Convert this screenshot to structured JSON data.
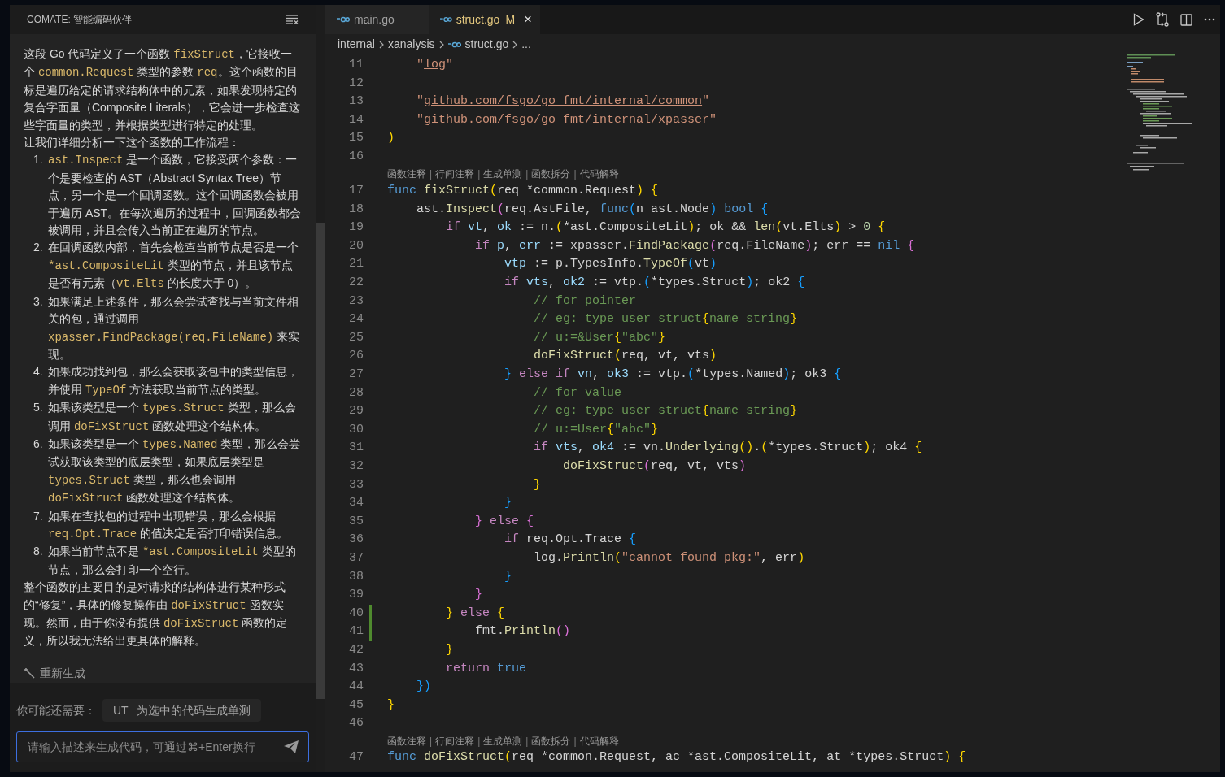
{
  "chat": {
    "title": "COMATE: 智能编码伙伴",
    "blocks": [
      {
        "kind": "para",
        "segments": [
          {
            "text": "这段 Go 代码定义了一个函数 ",
            "code": false
          },
          {
            "text": "fixStruct",
            "code": true
          },
          {
            "text": "，它接收一个 ",
            "code": false
          },
          {
            "text": "common.Request",
            "code": true
          },
          {
            "text": " 类型的参数 ",
            "code": false
          },
          {
            "text": "req",
            "code": true
          },
          {
            "text": "。这个函数的目标是遍历给定的请求结构体中的元素，如果发现特定的复合字面量（Composite Literals），它会进一步检查这些字面量的类型，并根据类型进行特定的处理。",
            "code": false
          }
        ]
      },
      {
        "kind": "para",
        "segments": [
          {
            "text": "让我们详细分析一下这个函数的工作流程：",
            "code": false
          }
        ]
      },
      {
        "kind": "item",
        "number": "1.",
        "segments": [
          {
            "text": "ast.Inspect",
            "code": true
          },
          {
            "text": " 是一个函数，它接受两个参数：一个是要检查的 AST（Abstract Syntax Tree）节点，另一个是一个回调函数。这个回调函数会被用于遍历 AST。在每次遍历的过程中，回调函数都会被调用，并且会传入当前正在遍历的节点。",
            "code": false
          }
        ]
      },
      {
        "kind": "item",
        "number": "2.",
        "segments": [
          {
            "text": "在回调函数内部，首先会检查当前节点是否是一个 ",
            "code": false
          },
          {
            "text": "*ast.CompositeLit",
            "code": true
          },
          {
            "text": " 类型的节点，并且该节点是否有元素（",
            "code": false
          },
          {
            "text": "vt.Elts",
            "code": true
          },
          {
            "text": " 的长度大于 0）。",
            "code": false
          }
        ]
      },
      {
        "kind": "item",
        "number": "3.",
        "segments": [
          {
            "text": "如果满足上述条件，那么会尝试查找与当前文件相关的包，通过调用 ",
            "code": false
          },
          {
            "text": "xpasser.FindPackage(req.FileName)",
            "code": true
          },
          {
            "text": " 来实现。",
            "code": false
          }
        ]
      },
      {
        "kind": "item",
        "number": "4.",
        "segments": [
          {
            "text": "如果成功找到包，那么会获取该包中的类型信息，并使用 ",
            "code": false
          },
          {
            "text": "TypeOf",
            "code": true
          },
          {
            "text": " 方法获取当前节点的类型。",
            "code": false
          }
        ]
      },
      {
        "kind": "item",
        "number": "5.",
        "segments": [
          {
            "text": "如果该类型是一个 ",
            "code": false
          },
          {
            "text": "types.Struct",
            "code": true
          },
          {
            "text": " 类型，那么会调用 ",
            "code": false
          },
          {
            "text": "doFixStruct",
            "code": true
          },
          {
            "text": " 函数处理这个结构体。",
            "code": false
          }
        ]
      },
      {
        "kind": "item",
        "number": "6.",
        "segments": [
          {
            "text": "如果该类型是一个 ",
            "code": false
          },
          {
            "text": "types.Named",
            "code": true
          },
          {
            "text": " 类型，那么会尝试获取该类型的底层类型，如果底层类型是 ",
            "code": false
          },
          {
            "text": "types.Struct",
            "code": true
          },
          {
            "text": " 类型，那么也会调用 ",
            "code": false
          },
          {
            "text": "doFixStruct",
            "code": true
          },
          {
            "text": " 函数处理这个结构体。",
            "code": false
          }
        ]
      },
      {
        "kind": "item",
        "number": "7.",
        "segments": [
          {
            "text": "如果在查找包的过程中出现错误，那么会根据 ",
            "code": false
          },
          {
            "text": "req.Opt.Trace",
            "code": true
          },
          {
            "text": " 的值决定是否打印错误信息。",
            "code": false
          }
        ]
      },
      {
        "kind": "item",
        "number": "8.",
        "segments": [
          {
            "text": "如果当前节点不是 ",
            "code": false
          },
          {
            "text": "*ast.CompositeLit",
            "code": true
          },
          {
            "text": " 类型的节点，那么会打印一个空行。",
            "code": false
          }
        ]
      },
      {
        "kind": "para",
        "segments": [
          {
            "text": "整个函数的主要目的是对请求的结构体进行某种形式的“修复”，具体的修复操作由 ",
            "code": false
          },
          {
            "text": "doFixStruct",
            "code": true
          },
          {
            "text": " 函数实现。然而，由于你没有提供 ",
            "code": false
          },
          {
            "text": "doFixStruct",
            "code": true
          },
          {
            "text": " 函数的定义，所以我无法给出更具体的解释。",
            "code": false
          }
        ]
      }
    ],
    "regenerate": "重新生成",
    "suggestion": {
      "label": "你可能还需要：",
      "prefix": "UT",
      "text": "为选中的代码生成单测"
    },
    "input": {
      "placeholder": "请输入描述来生成代码，可通过⌘+Enter换行"
    }
  },
  "tabs": [
    {
      "label": "main.go",
      "selected": false
    },
    {
      "label": "struct.go",
      "badge": "M",
      "close": "×",
      "selected": true
    }
  ],
  "breadcrumbs": [
    "internal",
    "xanalysis",
    "struct.go",
    "..."
  ],
  "lines": [
    {
      "kind": "code",
      "number": "11",
      "changed": false,
      "tokens": [
        {
          "text": "    \"",
          "kind": "s"
        },
        {
          "text": "log",
          "kind": "u"
        },
        {
          "text": "\"",
          "kind": "s"
        }
      ]
    },
    {
      "kind": "code",
      "number": "12",
      "changed": false
    },
    {
      "kind": "code",
      "number": "13",
      "changed": false,
      "tokens": [
        {
          "text": "    \"",
          "kind": "s"
        },
        {
          "text": "github.com/fsgo/go_fmt/internal/common",
          "kind": "u"
        },
        {
          "text": "\"",
          "kind": "s"
        }
      ]
    },
    {
      "kind": "code",
      "number": "14",
      "changed": false,
      "tokens": [
        {
          "text": "    \"",
          "kind": "s"
        },
        {
          "text": "github.com/fsgo/go_fmt/internal/xpasser",
          "kind": "u"
        },
        {
          "text": "\"",
          "kind": "s"
        }
      ]
    },
    {
      "kind": "code",
      "number": "15",
      "changed": false,
      "tokens": [
        {
          "text": ")",
          "kind": "b1"
        }
      ]
    },
    {
      "kind": "code",
      "number": "16",
      "changed": false
    },
    {
      "kind": "lens",
      "actions": [
        {
          "label": "函数注释",
          "kind": "link"
        },
        {
          "label": "|",
          "kind": "separator"
        },
        {
          "label": "行间注释",
          "kind": "link"
        },
        {
          "label": "|",
          "kind": "separator"
        },
        {
          "label": "生成单测",
          "kind": "link"
        },
        {
          "label": "|",
          "kind": "separator"
        },
        {
          "label": "函数拆分",
          "kind": "link"
        },
        {
          "label": "|",
          "kind": "separator"
        },
        {
          "label": "代码解释",
          "kind": "link"
        }
      ]
    },
    {
      "kind": "code",
      "number": "17",
      "changed": false,
      "tokens": [
        {
          "text": "func ",
          "kind": "bl"
        },
        {
          "text": "fixStruct",
          "kind": "f"
        },
        {
          "text": "(",
          "kind": "b1"
        },
        {
          "text": "req *common.Request",
          "kind": "p"
        },
        {
          "text": ") {",
          "kind": "b1"
        }
      ]
    },
    {
      "kind": "code",
      "number": "18",
      "changed": false,
      "tokens": [
        {
          "text": "    ast.",
          "kind": "p"
        },
        {
          "text": "Inspect",
          "kind": "f"
        },
        {
          "text": "(",
          "kind": "b2"
        },
        {
          "text": "req.AstFile, ",
          "kind": "p"
        },
        {
          "text": "func",
          "kind": "bl"
        },
        {
          "text": "(",
          "kind": "b3"
        },
        {
          "text": "n ast.Node",
          "kind": "p"
        },
        {
          "text": ") ",
          "kind": "b3"
        },
        {
          "text": "bool",
          "kind": "bl"
        },
        {
          "text": " {",
          "kind": "b3"
        }
      ]
    },
    {
      "kind": "code",
      "number": "19",
      "changed": false,
      "tokens": [
        {
          "text": "        if ",
          "kind": "kw"
        },
        {
          "text": "vt",
          "kind": "v"
        },
        {
          "text": ", ",
          "kind": "p"
        },
        {
          "text": "ok",
          "kind": "v"
        },
        {
          "text": " := n.",
          "kind": "p"
        },
        {
          "text": "(",
          "kind": "b1"
        },
        {
          "text": "*ast.CompositeLit",
          "kind": "p"
        },
        {
          "text": ")",
          "kind": "b1"
        },
        {
          "text": "; ok && ",
          "kind": "p"
        },
        {
          "text": "len",
          "kind": "f"
        },
        {
          "text": "(",
          "kind": "b1"
        },
        {
          "text": "vt.Elts",
          "kind": "p"
        },
        {
          "text": ")",
          "kind": "b1"
        },
        {
          "text": " > ",
          "kind": "p"
        },
        {
          "text": "0",
          "kind": "n"
        },
        {
          "text": " {",
          "kind": "b1"
        }
      ]
    },
    {
      "kind": "code",
      "number": "20",
      "changed": false,
      "tokens": [
        {
          "text": "            if ",
          "kind": "kw"
        },
        {
          "text": "p",
          "kind": "v"
        },
        {
          "text": ", ",
          "kind": "p"
        },
        {
          "text": "err",
          "kind": "v"
        },
        {
          "text": " := xpasser.",
          "kind": "p"
        },
        {
          "text": "FindPackage",
          "kind": "f"
        },
        {
          "text": "(",
          "kind": "b2"
        },
        {
          "text": "req.FileName",
          "kind": "p"
        },
        {
          "text": ")",
          "kind": "b2"
        },
        {
          "text": "; err == ",
          "kind": "p"
        },
        {
          "text": "nil",
          "kind": "bl"
        },
        {
          "text": " {",
          "kind": "b2"
        }
      ]
    },
    {
      "kind": "code",
      "number": "21",
      "changed": false,
      "tokens": [
        {
          "text": "                vtp",
          "kind": "v"
        },
        {
          "text": " := p.TypesInfo.",
          "kind": "p"
        },
        {
          "text": "TypeOf",
          "kind": "f"
        },
        {
          "text": "(",
          "kind": "b3"
        },
        {
          "text": "vt",
          "kind": "p"
        },
        {
          "text": ")",
          "kind": "b3"
        }
      ]
    },
    {
      "kind": "code",
      "number": "22",
      "changed": false,
      "tokens": [
        {
          "text": "                if ",
          "kind": "kw"
        },
        {
          "text": "vts",
          "kind": "v"
        },
        {
          "text": ", ",
          "kind": "p"
        },
        {
          "text": "ok2",
          "kind": "v"
        },
        {
          "text": " := vtp.",
          "kind": "p"
        },
        {
          "text": "(",
          "kind": "b3"
        },
        {
          "text": "*types.Struct",
          "kind": "p"
        },
        {
          "text": ")",
          "kind": "b3"
        },
        {
          "text": "; ok2 ",
          "kind": "p"
        },
        {
          "text": "{",
          "kind": "b3"
        }
      ]
    },
    {
      "kind": "code",
      "number": "23",
      "changed": false,
      "tokens": [
        {
          "text": "                    // for pointer",
          "kind": "c"
        }
      ]
    },
    {
      "kind": "code",
      "number": "24",
      "changed": false,
      "tokens": [
        {
          "text": "                    // eg: type user struct",
          "kind": "c"
        },
        {
          "text": "{",
          "kind": "b1"
        },
        {
          "text": "name string",
          "kind": "c"
        },
        {
          "text": "}",
          "kind": "b1"
        }
      ]
    },
    {
      "kind": "code",
      "number": "25",
      "changed": false,
      "tokens": [
        {
          "text": "                    // u:=&User",
          "kind": "c"
        },
        {
          "text": "{",
          "kind": "b1"
        },
        {
          "text": "\"abc\"",
          "kind": "c"
        },
        {
          "text": "}",
          "kind": "b1"
        }
      ]
    },
    {
      "kind": "code",
      "number": "26",
      "changed": false,
      "tokens": [
        {
          "text": "                    doFixStruct",
          "kind": "f"
        },
        {
          "text": "(",
          "kind": "b1"
        },
        {
          "text": "req, vt, vts",
          "kind": "p"
        },
        {
          "text": ")",
          "kind": "b1"
        }
      ]
    },
    {
      "kind": "code",
      "number": "27",
      "changed": false,
      "tokens": [
        {
          "text": "                } ",
          "kind": "b3"
        },
        {
          "text": "else if ",
          "kind": "kw"
        },
        {
          "text": "vn",
          "kind": "v"
        },
        {
          "text": ", ",
          "kind": "p"
        },
        {
          "text": "ok3",
          "kind": "v"
        },
        {
          "text": " := vtp.",
          "kind": "p"
        },
        {
          "text": "(",
          "kind": "b3"
        },
        {
          "text": "*types.Named",
          "kind": "p"
        },
        {
          "text": ")",
          "kind": "b3"
        },
        {
          "text": "; ok3 ",
          "kind": "p"
        },
        {
          "text": "{",
          "kind": "b3"
        }
      ]
    },
    {
      "kind": "code",
      "number": "28",
      "changed": false,
      "tokens": [
        {
          "text": "                    // for value",
          "kind": "c"
        }
      ]
    },
    {
      "kind": "code",
      "number": "29",
      "changed": false,
      "tokens": [
        {
          "text": "                    // eg: type user struct",
          "kind": "c"
        },
        {
          "text": "{",
          "kind": "b1"
        },
        {
          "text": "name string",
          "kind": "c"
        },
        {
          "text": "}",
          "kind": "b1"
        }
      ]
    },
    {
      "kind": "code",
      "number": "30",
      "changed": false,
      "tokens": [
        {
          "text": "                    // u:=User",
          "kind": "c"
        },
        {
          "text": "{",
          "kind": "b1"
        },
        {
          "text": "\"abc\"",
          "kind": "c"
        },
        {
          "text": "}",
          "kind": "b1"
        }
      ]
    },
    {
      "kind": "code",
      "number": "31",
      "changed": false,
      "tokens": [
        {
          "text": "                    if ",
          "kind": "kw"
        },
        {
          "text": "vts",
          "kind": "v"
        },
        {
          "text": ", ",
          "kind": "p"
        },
        {
          "text": "ok4",
          "kind": "v"
        },
        {
          "text": " := vn.",
          "kind": "p"
        },
        {
          "text": "Underlying",
          "kind": "f"
        },
        {
          "text": "()",
          "kind": "b1"
        },
        {
          "text": ".",
          "kind": "p"
        },
        {
          "text": "(",
          "kind": "b1"
        },
        {
          "text": "*types.Struct",
          "kind": "p"
        },
        {
          "text": ")",
          "kind": "b1"
        },
        {
          "text": "; ok4 ",
          "kind": "p"
        },
        {
          "text": "{",
          "kind": "b1"
        }
      ]
    },
    {
      "kind": "code",
      "number": "32",
      "changed": false,
      "tokens": [
        {
          "text": "                        doFixStruct",
          "kind": "f"
        },
        {
          "text": "(",
          "kind": "b2"
        },
        {
          "text": "req, vt, vts",
          "kind": "p"
        },
        {
          "text": ")",
          "kind": "b2"
        }
      ]
    },
    {
      "kind": "code",
      "number": "33",
      "changed": false,
      "tokens": [
        {
          "text": "                    }",
          "kind": "b1"
        }
      ]
    },
    {
      "kind": "code",
      "number": "34",
      "changed": false,
      "tokens": [
        {
          "text": "                }",
          "kind": "b3"
        }
      ]
    },
    {
      "kind": "code",
      "number": "35",
      "changed": false,
      "tokens": [
        {
          "text": "            } ",
          "kind": "b2"
        },
        {
          "text": "else ",
          "kind": "kw"
        },
        {
          "text": "{",
          "kind": "b2"
        }
      ]
    },
    {
      "kind": "code",
      "number": "36",
      "changed": false,
      "tokens": [
        {
          "text": "                if ",
          "kind": "kw"
        },
        {
          "text": "req.Opt.Trace ",
          "kind": "p"
        },
        {
          "text": "{",
          "kind": "b3"
        }
      ]
    },
    {
      "kind": "code",
      "number": "37",
      "changed": false,
      "tokens": [
        {
          "text": "                    log.",
          "kind": "p"
        },
        {
          "text": "Println",
          "kind": "f"
        },
        {
          "text": "(",
          "kind": "b1"
        },
        {
          "text": "\"cannot found pkg:\"",
          "kind": "s"
        },
        {
          "text": ", err",
          "kind": "p"
        },
        {
          "text": ")",
          "kind": "b1"
        }
      ]
    },
    {
      "kind": "code",
      "number": "38",
      "changed": false,
      "tokens": [
        {
          "text": "                }",
          "kind": "b3"
        }
      ]
    },
    {
      "kind": "code",
      "number": "39",
      "changed": false,
      "tokens": [
        {
          "text": "            }",
          "kind": "b2"
        }
      ]
    },
    {
      "kind": "code",
      "number": "40",
      "changed": true,
      "tokens": [
        {
          "text": "        } ",
          "kind": "b1"
        },
        {
          "text": "else ",
          "kind": "kw"
        },
        {
          "text": "{",
          "kind": "b1"
        }
      ]
    },
    {
      "kind": "code",
      "number": "41",
      "changed": true,
      "tokens": [
        {
          "text": "            fmt.",
          "kind": "p"
        },
        {
          "text": "Println",
          "kind": "f"
        },
        {
          "text": "()",
          "kind": "b2"
        }
      ]
    },
    {
      "kind": "code",
      "number": "42",
      "changed": false,
      "tokens": [
        {
          "text": "        }",
          "kind": "b1"
        }
      ]
    },
    {
      "kind": "code",
      "number": "43",
      "changed": false,
      "tokens": [
        {
          "text": "        return ",
          "kind": "kw"
        },
        {
          "text": "true",
          "kind": "bl"
        }
      ]
    },
    {
      "kind": "code",
      "number": "44",
      "changed": false,
      "tokens": [
        {
          "text": "    })",
          "kind": "b3"
        }
      ]
    },
    {
      "kind": "code",
      "number": "45",
      "changed": false,
      "tokens": [
        {
          "text": "}",
          "kind": "b1"
        }
      ]
    },
    {
      "kind": "code",
      "number": "46",
      "changed": false
    },
    {
      "kind": "lens",
      "actions": [
        {
          "label": "函数注释",
          "kind": "link"
        },
        {
          "label": "|",
          "kind": "separator"
        },
        {
          "label": "行间注释",
          "kind": "link"
        },
        {
          "label": "|",
          "kind": "separator"
        },
        {
          "label": "生成单测",
          "kind": "link"
        },
        {
          "label": "|",
          "kind": "separator"
        },
        {
          "label": "函数拆分",
          "kind": "link"
        },
        {
          "label": "|",
          "kind": "separator"
        },
        {
          "label": "代码解释",
          "kind": "link"
        }
      ]
    },
    {
      "kind": "code",
      "number": "47",
      "changed": false,
      "tokens": [
        {
          "text": "func ",
          "kind": "bl"
        },
        {
          "text": "doFixStruct",
          "kind": "f"
        },
        {
          "text": "(",
          "kind": "b1"
        },
        {
          "text": "req *common.Request, ac *ast.CompositeLit, at *types.Struct",
          "kind": "p"
        },
        {
          "text": ") {",
          "kind": "b1"
        }
      ]
    }
  ]
}
